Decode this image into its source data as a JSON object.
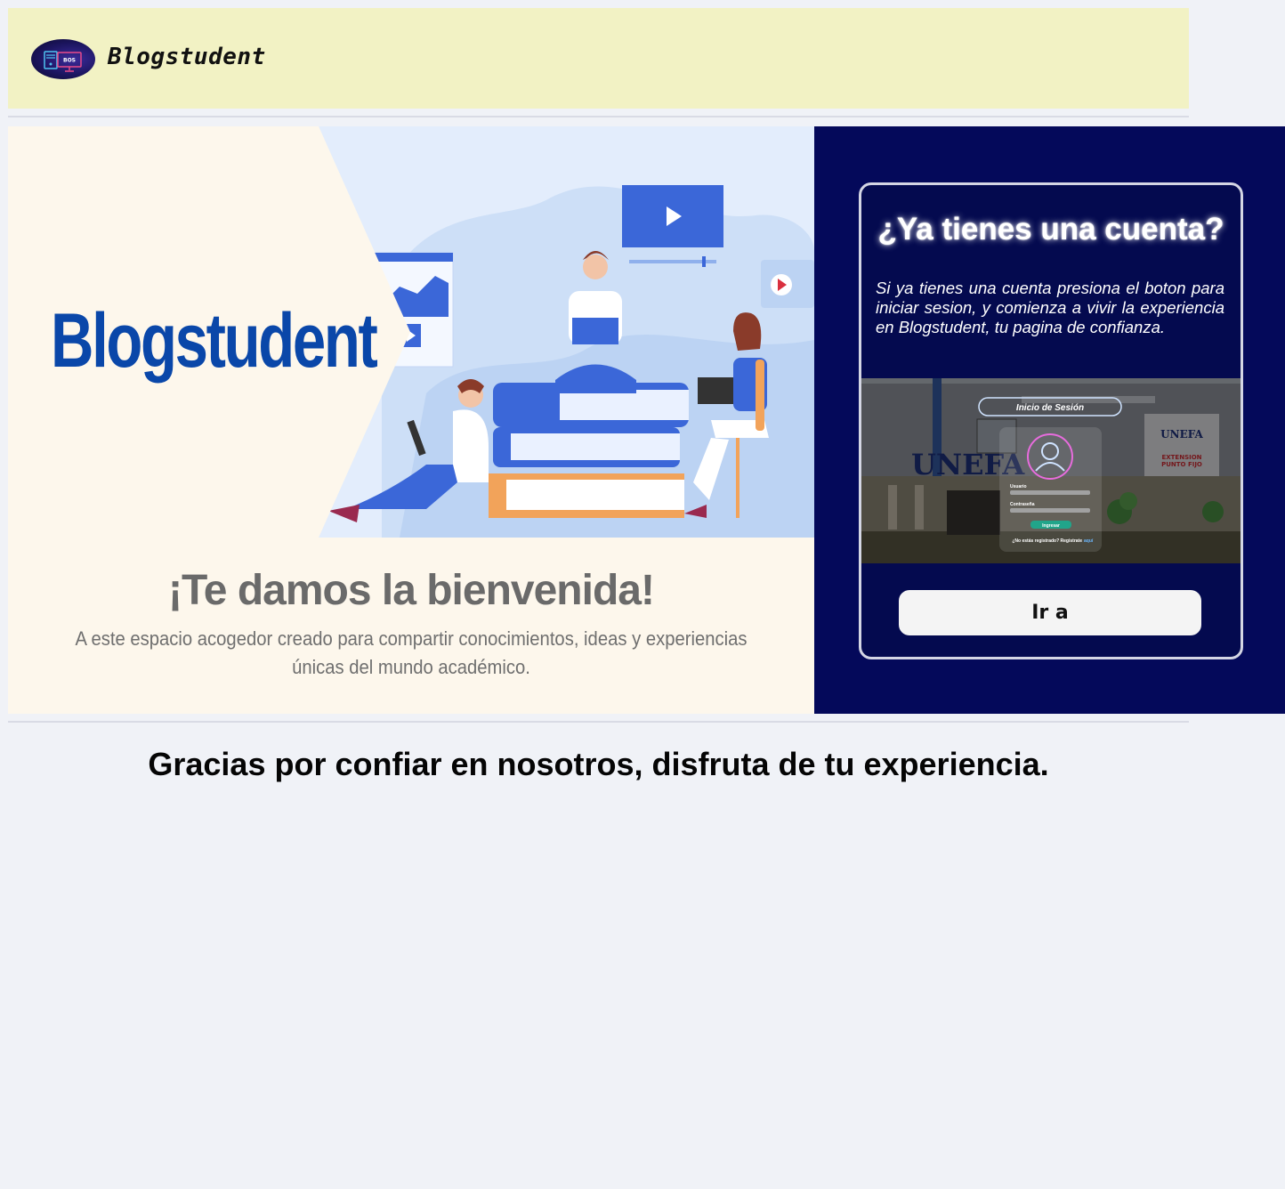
{
  "header": {
    "brand": "Blogstudent",
    "logo_text": "BOS"
  },
  "hero": {
    "brand": "Blogstudent",
    "welcome": "¡Te damos la bienvenida!",
    "subtitle": "A este espacio acogedor creado para compartir conocimientos, ideas y experiencias únicas del mundo académico."
  },
  "login_card": {
    "title": "¿Ya tienes una cuenta?",
    "text": "Si ya tienes una cuenta presiona el boton para iniciar sesion, y comienza a vivir la experiencia en Blogstudent, tu pagina de confianza.",
    "button_label": "Ir a",
    "preview": {
      "heading": "Inicio de Sesión",
      "building_text": "UNEFA",
      "sign_title": "UNEFA",
      "sign_extension": "EXTENSION",
      "sign_place": "PUNTO FIJO",
      "user_label": "Usuario",
      "password_label": "Contraseña",
      "submit_label": "Ingresar",
      "register_text": "¿No estás registrado? Registrate",
      "register_link": "aquí"
    }
  },
  "footer": {
    "message": "Gracias por confiar en nosotros, disfruta de tu experiencia."
  },
  "colors": {
    "header_bg": "#f2f2c4",
    "page_bg": "#f0f2f7",
    "panel_bg": "#04095a",
    "hero_brand": "#0a47a9",
    "illustration_blue": "#3b67d8"
  }
}
